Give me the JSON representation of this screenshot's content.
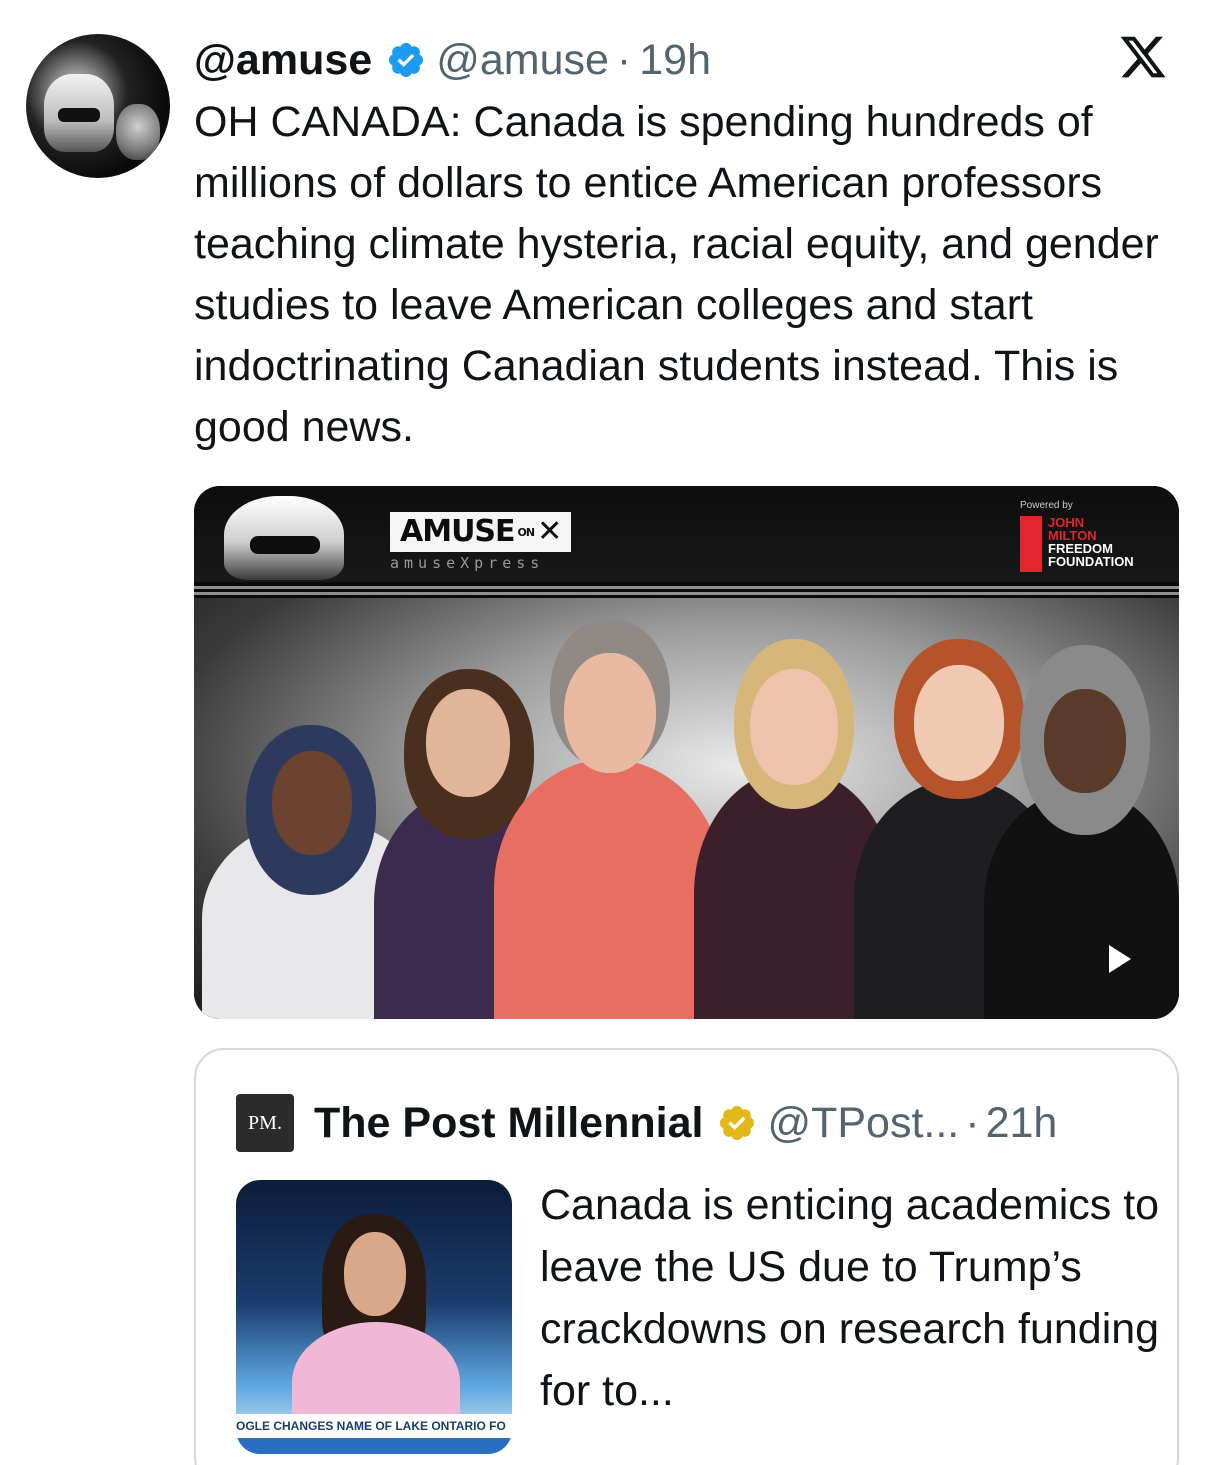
{
  "tweet": {
    "display_name": "@amuse",
    "handle": "@amuse",
    "separator": "·",
    "time": "19h",
    "text": "OH CANADA: Canada is spending hundreds of millions of dollars to entice American professors teaching climate hysteria, racial equity, and gender studies to leave American colleges and start indoctrinating Canadian students instead. This is good news.",
    "verified_color": "#1d9bf0"
  },
  "media": {
    "logo_text": "AMUSE",
    "logo_on": "ON",
    "logo_sub": "amuseXpress",
    "powered_by": "Powered by",
    "sponsor_line1": "JOHN",
    "sponsor_line2": "MILTON",
    "sponsor_line3": "FREEDOM",
    "sponsor_line4": "FOUNDATION"
  },
  "quote": {
    "logo": "PM.",
    "name": "The Post Millennial",
    "handle": "@TPost...",
    "separator": "·",
    "time": "21h",
    "text": "Canada is enticing academics to leave the US due to Trump’s crackdowns on research funding for to...",
    "thumb_chyron": "OGLE CHANGES NAME OF LAKE ONTARIO FO",
    "verified_color": "#e2b719"
  }
}
